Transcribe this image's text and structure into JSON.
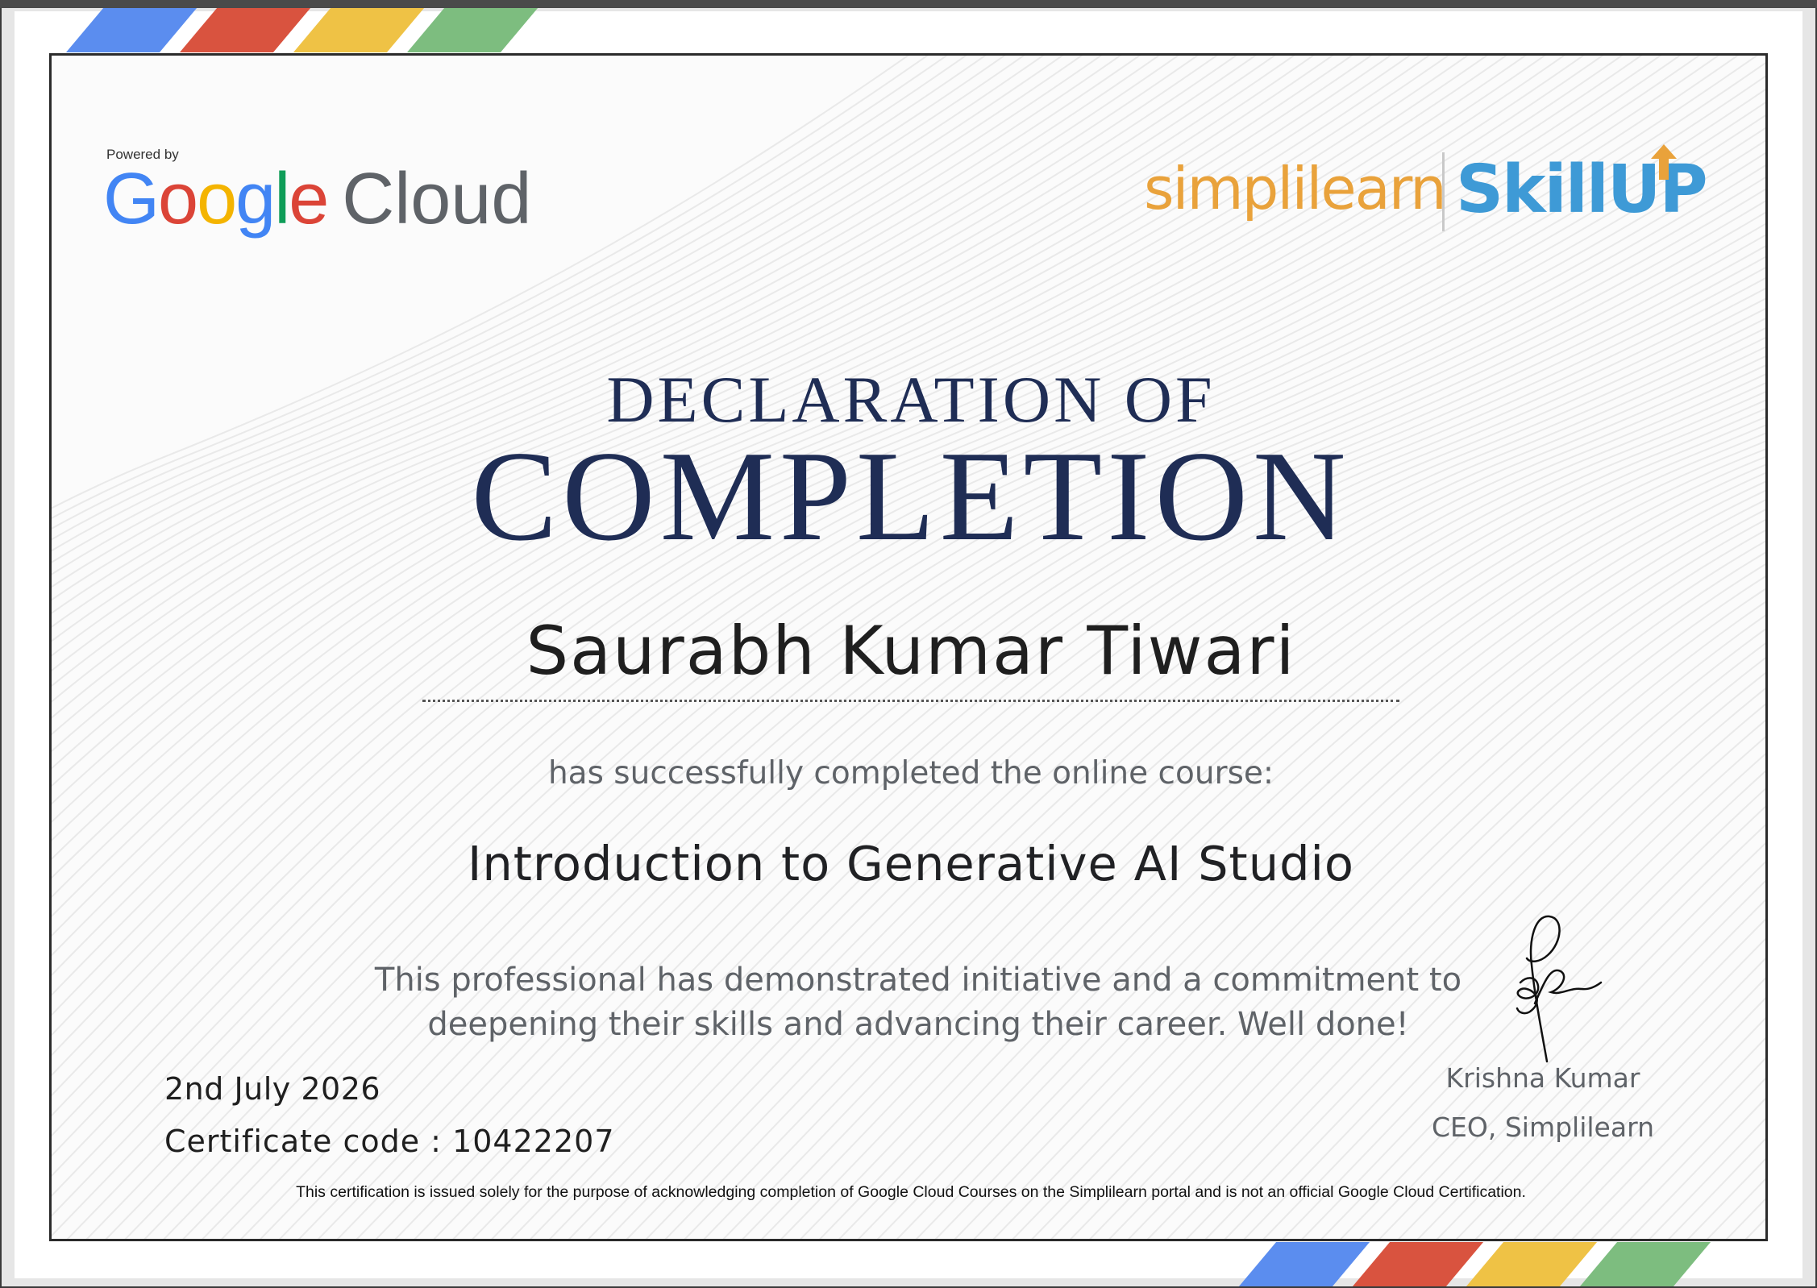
{
  "colors": {
    "google_blue": "#4285f4",
    "google_red": "#db4437",
    "google_yellow": "#f4b400",
    "google_green": "#0f9d58",
    "stripe_blue": "#5b8def",
    "stripe_red": "#d9533f",
    "stripe_yellow": "#efc245",
    "stripe_green": "#7dbd7f",
    "title_navy": "#1f2d55",
    "simplilearn_orange": "#e9a23b",
    "skillup_blue": "#3e9ad6"
  },
  "logos": {
    "powered_by": "Powered by",
    "google_letters": [
      "G",
      "o",
      "o",
      "g",
      "l",
      "e"
    ],
    "google_cloud_word": "Cloud",
    "simplilearn": "simplilearn",
    "skillup": "SkillUP",
    "skillup_icon": "up-arrow-icon"
  },
  "certificate": {
    "title_line1": "DECLARATION OF",
    "title_line2": "COMPLETION",
    "recipient_name": "Saurabh Kumar Tiwari",
    "completed_text": "has successfully completed the online course:",
    "course_name": "Introduction to Generative AI Studio",
    "praise_line1": "This professional has demonstrated initiative and a commitment to",
    "praise_line2": "deepening their skills and advancing their career. Well done!",
    "date": "2nd July 2026",
    "code_label": "Certificate code : ",
    "code_value": "10422207",
    "signer_name": "Krishna Kumar",
    "signer_title": "CEO, Simplilearn",
    "disclaimer": "This certification is issued solely for the purpose of acknowledging completion of Google Cloud Courses on the Simplilearn portal and is not an official Google Cloud Certification."
  }
}
